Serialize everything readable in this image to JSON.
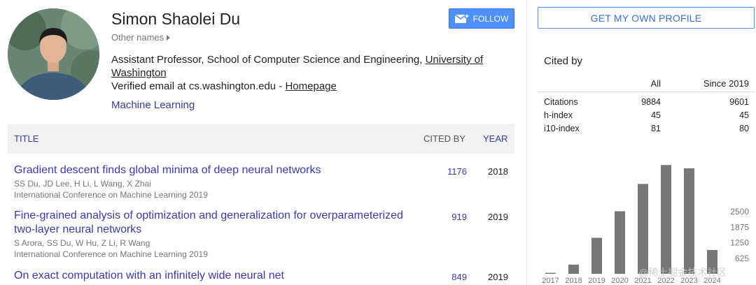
{
  "profile": {
    "name": "Simon Shaolei Du",
    "other_names": "Other names",
    "affiliation_prefix": "Assistant Professor, School of Computer Science and Engineering, ",
    "affiliation_link": "University of Washington",
    "email_text": "Verified email at cs.washington.edu - ",
    "homepage_link": "Homepage",
    "interest": "Machine Learning",
    "follow_label": "FOLLOW"
  },
  "articles": {
    "headers": {
      "title": "TITLE",
      "cited_by": "CITED BY",
      "year": "YEAR"
    },
    "rows": [
      {
        "title": "Gradient descent finds global minima of deep neural networks",
        "authors": "SS Du, JD Lee, H Li, L Wang, X Zhai",
        "venue": "International Conference on Machine Learning 2019",
        "cited_by": "1176",
        "year": "2018"
      },
      {
        "title": "Fine-grained analysis of optimization and generalization for overparameterized two-layer neural networks",
        "authors": "S Arora, SS Du, W Hu, Z Li, R Wang",
        "venue": "International Conference on Machine Learning 2019",
        "cited_by": "919",
        "year": "2019"
      },
      {
        "title": "On exact computation with an infinitely wide neural net",
        "authors": "",
        "venue": "",
        "cited_by": "849",
        "year": "2019"
      }
    ]
  },
  "sidebar": {
    "profile_button": "GET MY OWN PROFILE",
    "cited_by_title": "Cited by",
    "stats_headers": {
      "all": "All",
      "since": "Since 2019"
    },
    "stats": [
      {
        "label": "Citations",
        "all": "9884",
        "since": "9601"
      },
      {
        "label": "h-index",
        "all": "45",
        "since": "45"
      },
      {
        "label": "i10-index",
        "all": "81",
        "since": "80"
      }
    ],
    "watermark": "@稀土掘金技术社区"
  },
  "chart_data": {
    "type": "bar",
    "categories": [
      "2017",
      "2018",
      "2019",
      "2020",
      "2021",
      "2022",
      "2023",
      "2024"
    ],
    "values": [
      40,
      370,
      1450,
      2520,
      3620,
      4380,
      4250,
      960
    ],
    "y_ticks": [
      "2500",
      "1875",
      "1250",
      "625"
    ],
    "ylim": [
      0,
      4500
    ],
    "bar_color": "#777777",
    "grid": false
  },
  "colors": {
    "link": "#3a3ab0",
    "button_blue": "#4d90fe",
    "header_bg": "#f2f2f2"
  }
}
